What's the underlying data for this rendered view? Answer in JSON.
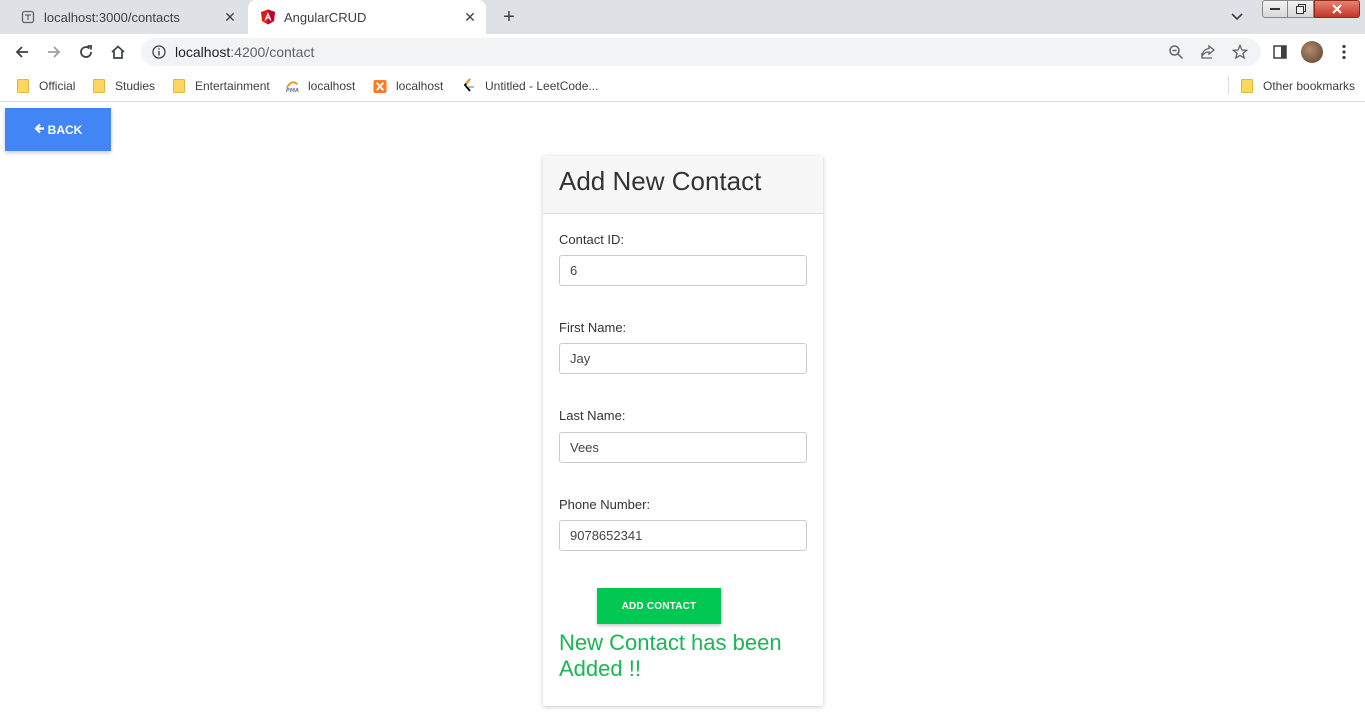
{
  "browser": {
    "tabs": [
      {
        "title": "localhost:3000/contacts",
        "icon": "document-icon",
        "active": false
      },
      {
        "title": "AngularCRUD",
        "icon": "angular-icon",
        "active": true
      }
    ],
    "close_glyph": "✕",
    "new_tab_glyph": "+",
    "address": {
      "host": "localhost",
      "path": ":4200/contact"
    }
  },
  "bookmarks": [
    {
      "label": "Official",
      "icon": "folder-icon"
    },
    {
      "label": "Studies",
      "icon": "folder-icon"
    },
    {
      "label": "Entertainment",
      "icon": "folder-icon"
    },
    {
      "label": "localhost",
      "icon": "phpmyadmin-icon"
    },
    {
      "label": "localhost",
      "icon": "xampp-icon"
    },
    {
      "label": "Untitled - LeetCode...",
      "icon": "leetcode-icon"
    }
  ],
  "other_bookmarks": "Other bookmarks",
  "page": {
    "back_label": "BACK",
    "form": {
      "title": "Add New Contact",
      "fields": [
        {
          "label": "Contact ID:",
          "value": "6"
        },
        {
          "label": "First Name:",
          "value": "Jay"
        },
        {
          "label": "Last Name:",
          "value": "Vees"
        },
        {
          "label": "Phone Number:",
          "value": "9078652341"
        }
      ],
      "submit_label": "ADD CONTACT",
      "success_message": "New Contact has been Added !!"
    }
  },
  "colors": {
    "back_button": "#4285f4",
    "submit_button": "#00c853",
    "success_text": "#1ab653"
  }
}
